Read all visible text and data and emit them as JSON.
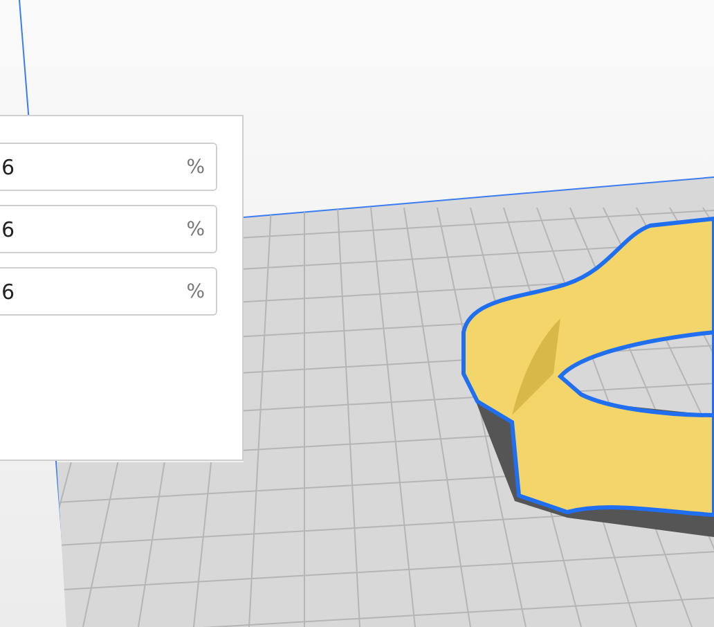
{
  "scale_panel": {
    "fields": [
      {
        "value": "6",
        "unit": "%"
      },
      {
        "value": "6",
        "unit": "%"
      },
      {
        "value": "6",
        "unit": "%"
      }
    ]
  }
}
